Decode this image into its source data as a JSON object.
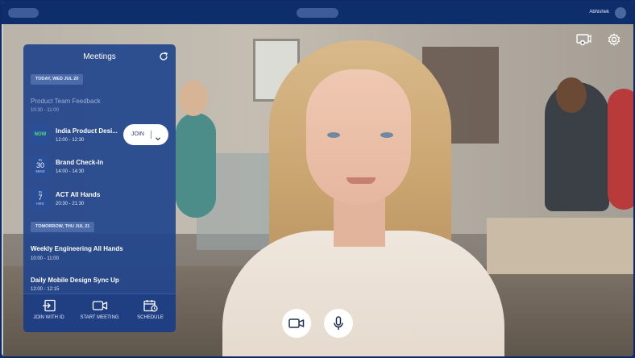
{
  "topbar": {
    "user_name": "Abhishek"
  },
  "panel": {
    "title": "Meetings",
    "sections": [
      {
        "date_label": "TODAY, WED JUL 20"
      },
      {
        "date_label": "TOMORROW, THU JUL 21"
      }
    ],
    "meetings": [
      {
        "title": "Product Team Feedback",
        "time": "10:30 - 11:00"
      },
      {
        "badge_text": "NOW",
        "title": "India Product Desi...",
        "time": "12:00 - 12:30"
      },
      {
        "badge_top": "IN",
        "badge_num": "30",
        "badge_unit": "MINS",
        "title": "Brand Check-In",
        "time": "14:00 - 14:30"
      },
      {
        "badge_top": "IN",
        "badge_num": "7",
        "badge_unit": "HRS",
        "title": "ACT All Hands",
        "time": "20:30 - 21:30"
      },
      {
        "title": "Weekly Engineering All Hands",
        "time": "10:00 - 11:00"
      },
      {
        "title": "Daily Mobile Design Sync Up",
        "time": "12:00 - 12:15"
      }
    ],
    "join_button": {
      "label": "JOIN"
    },
    "footer": [
      {
        "label": "JOIN WITH ID",
        "icon": "join-id-icon"
      },
      {
        "label": "START MEETING",
        "icon": "video-camera-icon"
      },
      {
        "label": "SCHEDULE",
        "icon": "calendar-clock-icon"
      }
    ]
  },
  "icons": {
    "refresh": "refresh-icon",
    "screen_share": "screen-share-icon",
    "settings": "gear-icon",
    "camera": "video-camera-icon",
    "microphone": "microphone-icon"
  }
}
